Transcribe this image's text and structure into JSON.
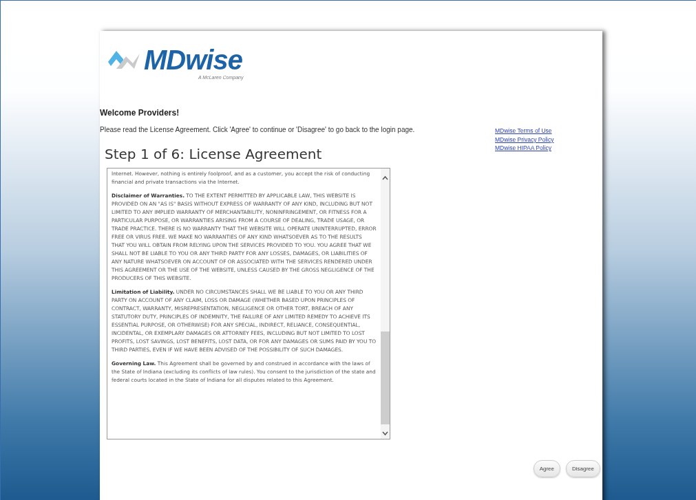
{
  "logo": {
    "name": "MDwise",
    "tagline": "A McLaren Company"
  },
  "welcome": "Welcome Providers!",
  "instruction": "Please read the License Agreement. Click 'Agree' to continue or 'Disagree' to go back to the login page.",
  "links": [
    "MDwise Terms of Use",
    "MDwise Privacy Policy",
    "MDwise HIPAA Policy"
  ],
  "step_title": "Step 1 of 6: License Agreement",
  "agreement_paragraphs": [
    "Internet. However, nothing is entirely foolproof, and as a customer, you accept the risk of conducting financial and private transactions via the Internet.",
    "**Disclaimer of Warranties.** TO THE EXTENT PERMITTED BY APPLICABLE LAW, THIS WEBSITE IS PROVIDED ON AN \"AS IS\" BASIS WITHOUT EXPRESS OF WARRANTY OF ANY KIND, INCLUDING BUT NOT LIMITED TO ANY IMPLIED WARRANTY OF MERCHANTABILITY, NONINFRINGEMENT, OR FITNESS FOR A PARTICULAR PURPOSE, OR WARRANTIES ARISING FROM A COURSE OF DEALING, TRADE USAGE, OR TRADE PRACTICE. THERE IS NO WARRANTY THAT THE WEBSITE WILL OPERATE UNINTERRUPTED, ERROR FREE OR VIRUS FREE. WE MAKE NO WARRANTIES OF ANY KIND WHATSOEVER AS TO THE RESULTS THAT YOU WILL OBTAIN FROM RELYING UPON THE SERVICES PROVIDED TO YOU. YOU AGREE THAT WE SHALL NOT BE LIABLE TO YOU OR ANY THIRD PARTY FOR ANY LOSSES, DAMAGES, OR LIABILITIES OF ANY NATURE WHATSOEVER ON ACCOUNT OF OR ASSOCIATED WITH THE SERVICES RENDERED UNDER THIS AGREEMENT OR THE USE OF THE WEBSITE, UNLESS CAUSED BY THE GROSS NEGLIGENCE OF THE PRODUCERS OF THIS WEBSITE.",
    "**Limitation of Liability.** UNDER NO CIRCUMSTANCES SHALL WE BE LIABLE TO YOU OR ANY THIRD PARTY ON ACCOUNT OF ANY CLAIM, LOSS OR DAMAGE (WHETHER BASED UPON PRINCIPLES OF CONTRACT, WARRANTY, MISREPRESENTATION, NEGLIGENCE OR OTHER TORT, BREACH OF ANY STATUTORY DUTY, PRINCIPLES OF INDEMNITY, THE FAILURE OF ANY LIMITED REMEDY TO ACHIEVE ITS ESSENTIAL PURPOSE, OR OTHERWISE) FOR ANY SPECIAL, INDIRECT, RELIANCE, CONSEQUENTIAL, INCIDENTAL, OR EXEMPLARY DAMAGES OR ATTORNEY FEES, INCLUDING BUT NOT LIMITED TO LOST PROFITS, LOST SAVINGS, LOST BENEFITS, LOST DATA, OR FOR ANY DAMAGES OR SUMS PAID BY YOU TO THIRD PARTIES, EVEN IF WE HAVE BEEN ADVISED OF THE POSSIBILITY OF SUCH DAMAGES.",
    "**Governing Law.** This Agreement shall be governed by and construed in accordance with the laws of the State of Indiana (excluding its conflicts of law rules). You consent to the jurisdiction of the state and federal courts located in the State of Indiana for all disputes related to this Agreement."
  ],
  "buttons": [
    "Agree",
    "Disagree"
  ]
}
